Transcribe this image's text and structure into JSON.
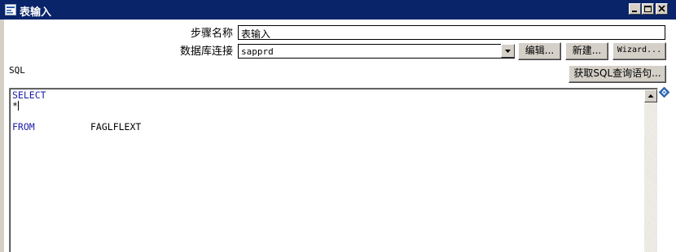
{
  "window": {
    "title": "表输入",
    "icon": "table-input-icon",
    "controls": [
      "minimize-icon",
      "maximize-icon",
      "close-icon"
    ]
  },
  "form": {
    "step_name_label": "步骤名称",
    "step_name_value": "表输入",
    "db_connection_label": "数据库连接",
    "db_connection_value": "sapprd",
    "edit_button": "编辑...",
    "new_button": "新建...",
    "wizard_button": "Wizard...",
    "sql_label": "SQL",
    "get_sql_button": "获取SQL查询语句..."
  },
  "editor": {
    "lines": [
      {
        "keyword": "SELECT",
        "rest": ""
      },
      {
        "keyword": "",
        "rest": "*"
      },
      {
        "keyword": "",
        "rest": ""
      },
      {
        "keyword": "FROM",
        "rest": "FAGLFLEXT"
      }
    ]
  },
  "colors": {
    "titlebar": "#0a246a",
    "keyword": "#1a1aa6",
    "button_face": "#d4d0c8"
  }
}
